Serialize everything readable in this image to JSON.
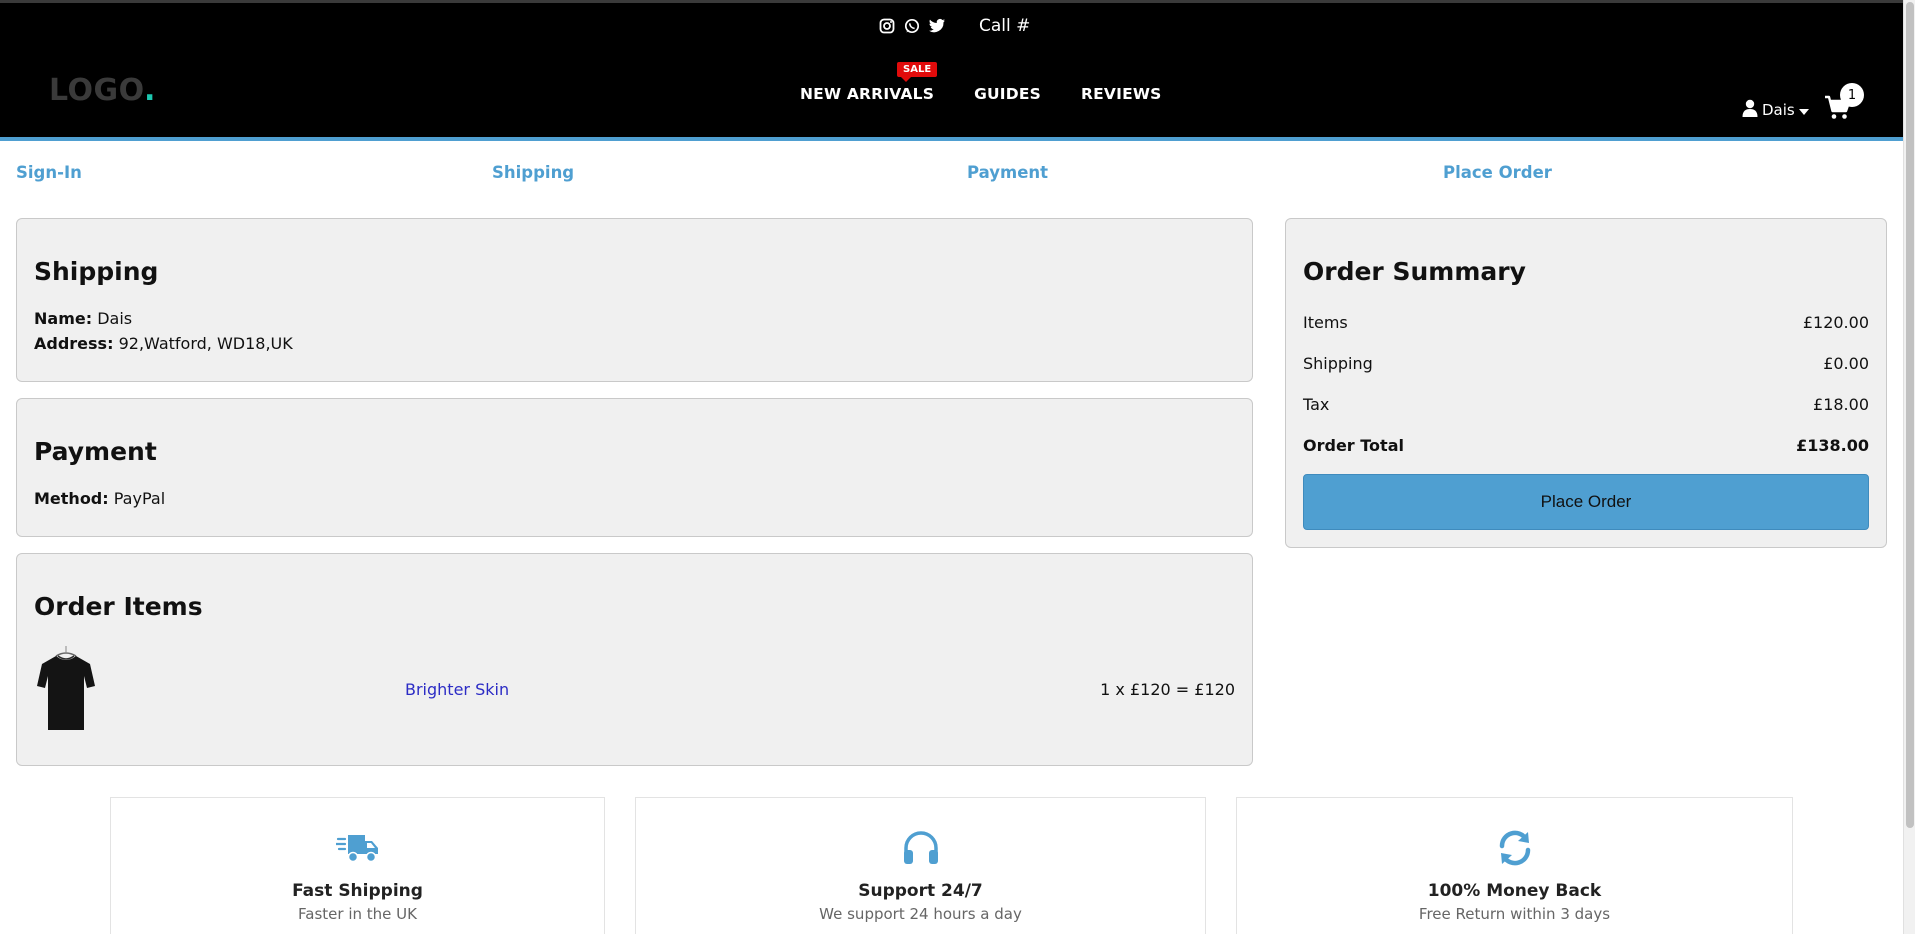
{
  "header": {
    "call_label": "Call #",
    "logo_text": "LOGO",
    "logo_dot": ".",
    "sale_badge": "SALE",
    "nav": [
      "NEW ARRIVALS",
      "GUIDES",
      "REVIEWS"
    ],
    "user_name": "Dais",
    "cart_count": "1",
    "icons": [
      "instagram-icon",
      "whatsapp-icon",
      "twitter-icon",
      "user-icon",
      "caret-down-icon",
      "cart-icon"
    ]
  },
  "steps": [
    "Sign-In",
    "Shipping",
    "Payment",
    "Place Order"
  ],
  "shipping": {
    "title": "Shipping",
    "name_label": "Name:",
    "name_value": "Dais",
    "address_label": "Address:",
    "address_value": "92,Watford, WD18,UK"
  },
  "payment": {
    "title": "Payment",
    "method_label": "Method:",
    "method_value": "PayPal"
  },
  "order_items": {
    "title": "Order Items",
    "items": [
      {
        "name": "Brighter Skin",
        "price_line": "1 x £120 = £120",
        "image": "black t-shirt"
      }
    ]
  },
  "summary": {
    "title": "Order Summary",
    "rows": [
      {
        "label": "Items",
        "value": "£120.00"
      },
      {
        "label": "Shipping",
        "value": "£0.00"
      },
      {
        "label": "Tax",
        "value": "£18.00"
      },
      {
        "label": "Order Total",
        "value": "£138.00"
      }
    ],
    "button_label": "Place Order"
  },
  "features": [
    {
      "icon": "truck-icon",
      "title": "Fast Shipping",
      "subtitle": "Faster in the UK"
    },
    {
      "icon": "headphones-icon",
      "title": "Support 24/7",
      "subtitle": "We support 24 hours a day"
    },
    {
      "icon": "refresh-icon",
      "title": "100% Money Back",
      "subtitle": "Free Return within 3 days"
    }
  ],
  "colors": {
    "accent": "#4f9fd1",
    "sale": "#e10b0b",
    "header_bg": "#000000",
    "panel_bg": "#f0f0f0",
    "logo_dot": "#1cc7b0",
    "link": "#2c2cc5"
  }
}
